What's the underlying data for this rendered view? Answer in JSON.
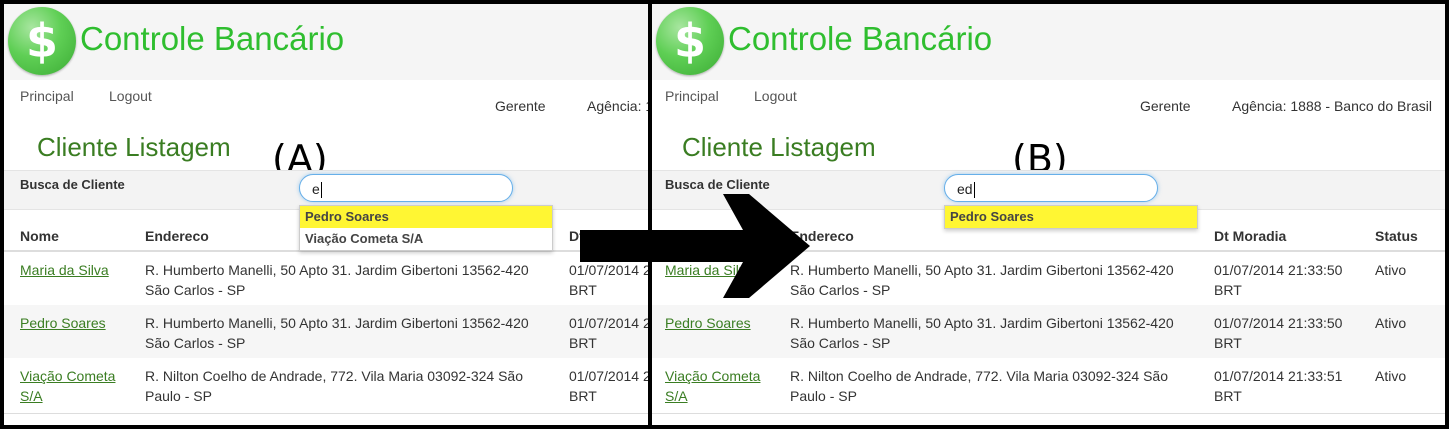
{
  "app": {
    "dollar": "$",
    "title": "Controle Bancário",
    "nav": [
      "Principal",
      "Logout"
    ],
    "role": "Gerente",
    "agency": "Agência: 1888 - Banco do Brasil"
  },
  "page_title": "Cliente Listagem",
  "search": {
    "label": "Busca de Cliente"
  },
  "columns": [
    "Nome",
    "Endereco",
    "Dt Moradia",
    "Status"
  ],
  "rows": [
    {
      "nome": "Maria da Silva",
      "endereco": "R. Humberto Manelli, 50 Apto 31. Jardim Gibertoni 13562-420 São Carlos - SP",
      "dt": "01/07/2014 21:33:50 BRT",
      "status": "Ativo"
    },
    {
      "nome": "Pedro Soares",
      "endereco": "R. Humberto Manelli, 50 Apto 31. Jardim Gibertoni 13562-420 São Carlos - SP",
      "dt": "01/07/2014 21:33:50 BRT",
      "status": "Ativo"
    },
    {
      "nome": "Viação Cometa S/A",
      "endereco": "R. Nilton Coelho de Andrade, 772. Vila Maria 03092-324 São Paulo - SP",
      "dt": "01/07/2014 21:33:51 BRT",
      "status": "Ativo"
    }
  ],
  "panels": [
    {
      "label": "(A)",
      "query": "e",
      "suggestions": [
        "Pedro Soares",
        "Viação Cometa S/A"
      ]
    },
    {
      "label": "(B)",
      "query": "ed",
      "suggestions": [
        "Pedro Soares"
      ]
    }
  ]
}
